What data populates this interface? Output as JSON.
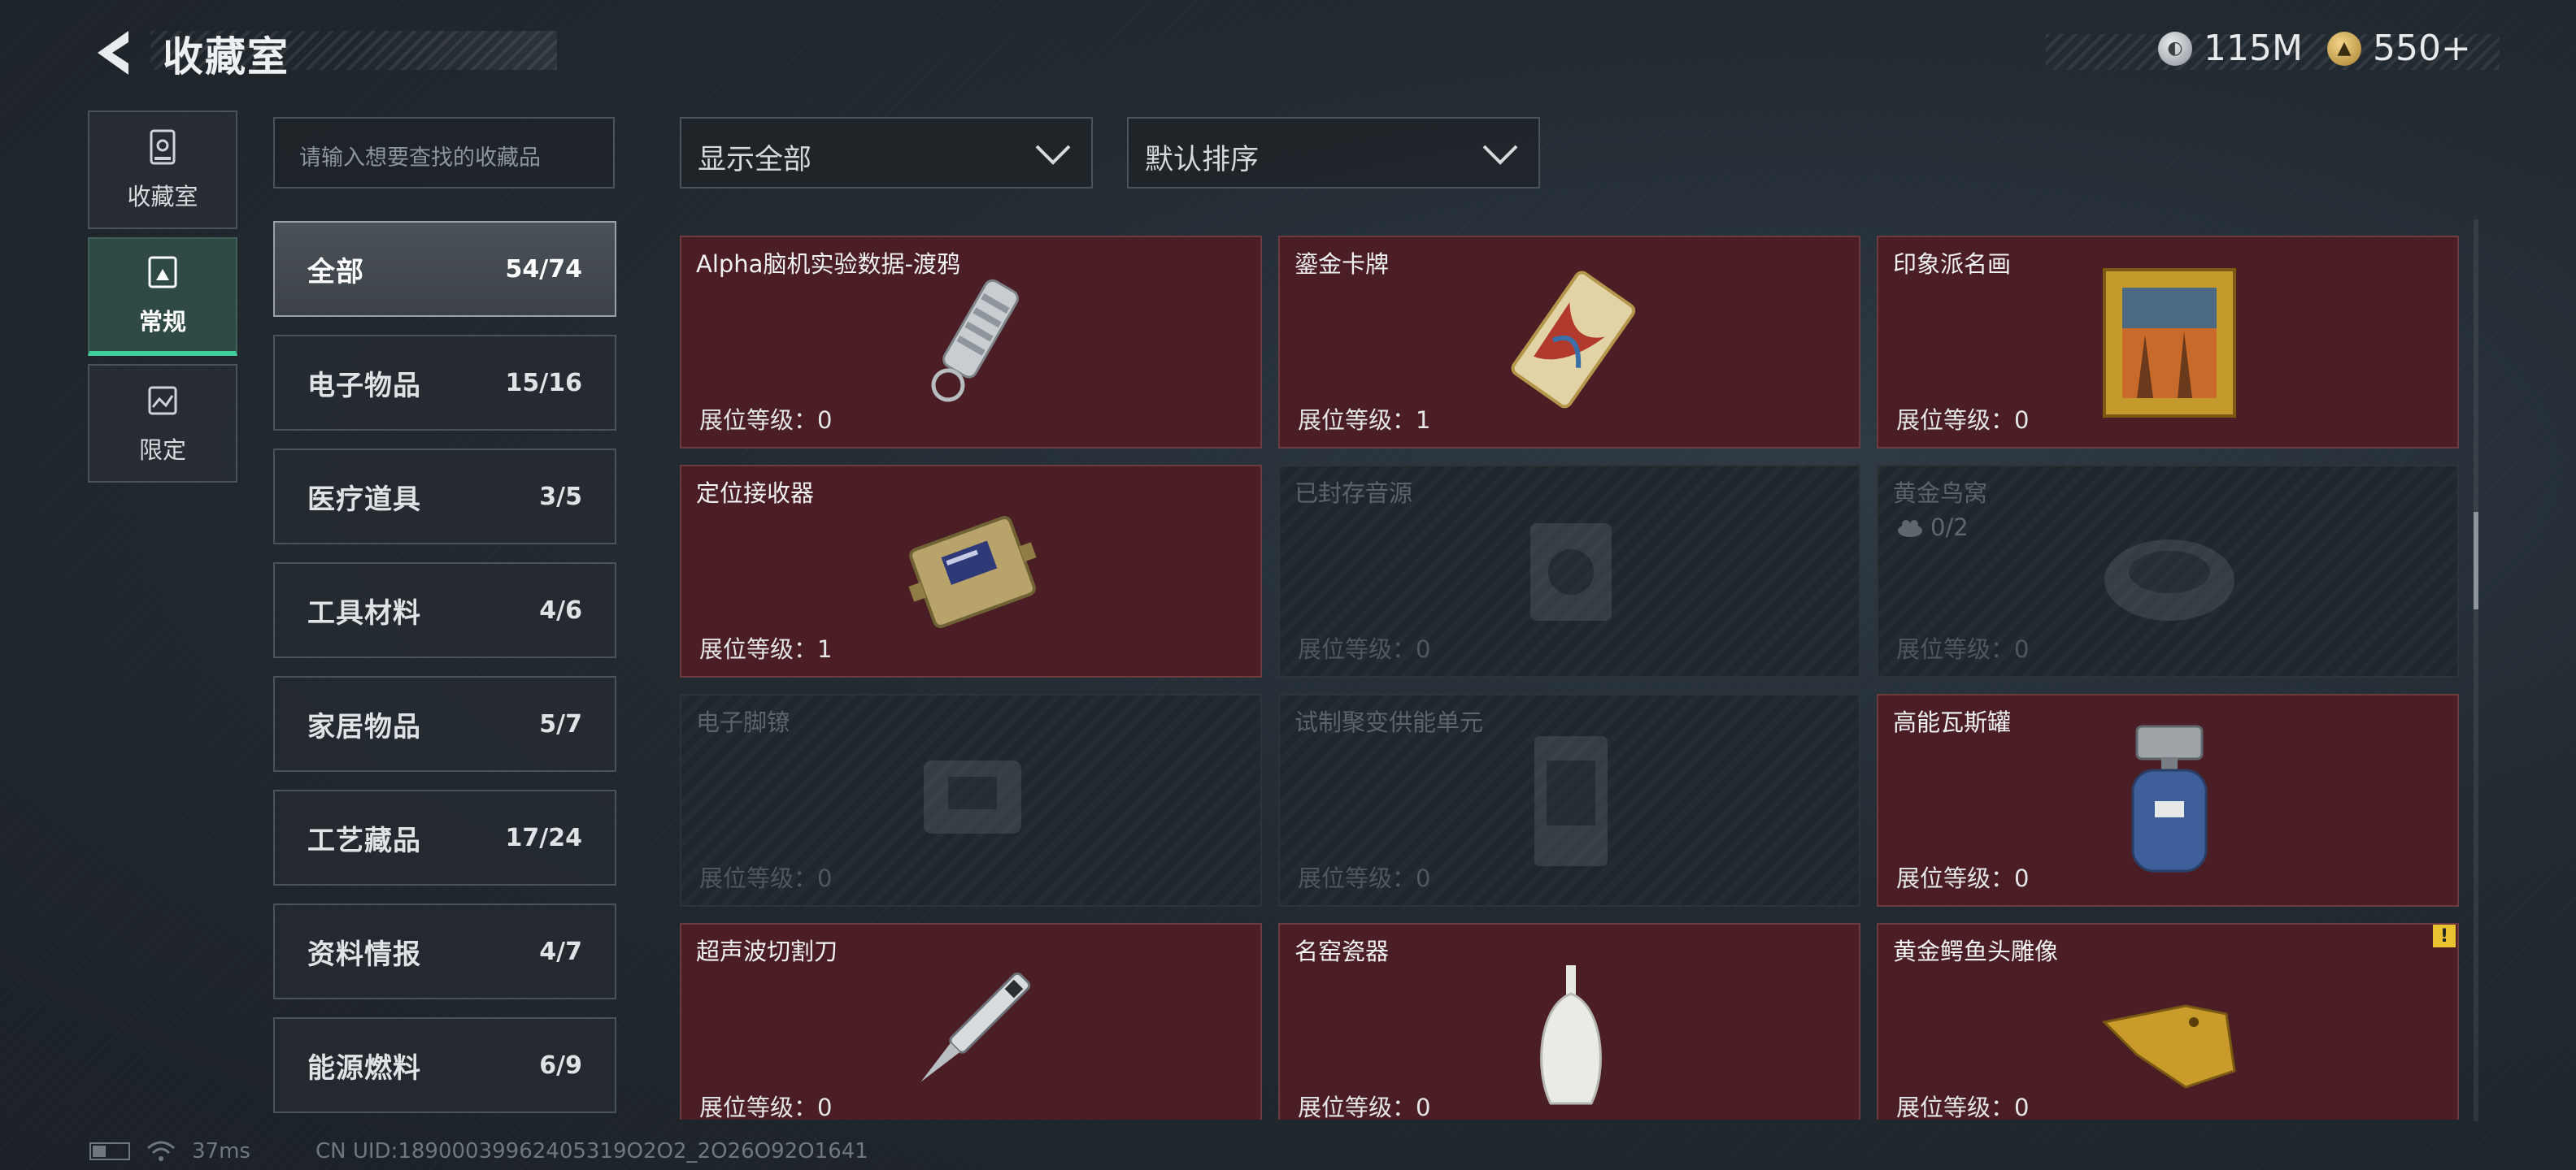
{
  "header": {
    "title": "收藏室"
  },
  "currencies": [
    {
      "icon": "silver-coin-icon",
      "value": "115M"
    },
    {
      "icon": "gold-coin-icon",
      "value": "550+"
    }
  ],
  "nav": [
    {
      "label": "收藏室",
      "icon": "collection-room-icon",
      "active": false
    },
    {
      "label": "常规",
      "icon": "regular-collection-icon",
      "active": true
    },
    {
      "label": "限定",
      "icon": "limited-collection-icon",
      "active": false
    }
  ],
  "search": {
    "placeholder": "请输入想要查找的收藏品"
  },
  "categories": [
    {
      "name": "全部",
      "count": "54/74",
      "active": true
    },
    {
      "name": "电子物品",
      "count": "15/16"
    },
    {
      "name": "医疗道具",
      "count": "3/5"
    },
    {
      "name": "工具材料",
      "count": "4/6"
    },
    {
      "name": "家居物品",
      "count": "5/7"
    },
    {
      "name": "工艺藏品",
      "count": "17/24"
    },
    {
      "name": "资料情报",
      "count": "4/7"
    },
    {
      "name": "能源燃料",
      "count": "6/9"
    }
  ],
  "filters": {
    "show": "显示全部",
    "sort": "默认排序"
  },
  "items": [
    {
      "name": "Alpha脑机实验数据-渡鸦",
      "level": "展位等级：0",
      "locked": false,
      "art": "data-drive-icon"
    },
    {
      "name": "鎏金卡牌",
      "level": "展位等级：1",
      "locked": false,
      "art": "gold-card-icon"
    },
    {
      "name": "印象派名画",
      "level": "展位等级：0",
      "locked": false,
      "art": "painting-icon"
    },
    {
      "name": "定位接收器",
      "level": "展位等级：1",
      "locked": false,
      "art": "receiver-icon"
    },
    {
      "name": "已封存音源",
      "level": "展位等级：0",
      "locked": true,
      "art": "sealed-audio-icon"
    },
    {
      "name": "黄金鸟窝",
      "level": "展位等级：0",
      "locked": true,
      "art": "golden-nest-icon",
      "progress": "0/2"
    },
    {
      "name": "电子脚镣",
      "level": "展位等级：0",
      "locked": true,
      "art": "ankle-monitor-icon"
    },
    {
      "name": "试制聚变供能单元",
      "level": "展位等级：0",
      "locked": true,
      "art": "fusion-unit-icon"
    },
    {
      "name": "高能瓦斯罐",
      "level": "展位等级：0",
      "locked": false,
      "art": "gas-tank-icon"
    },
    {
      "name": "超声波切割刀",
      "level": "展位等级：0",
      "locked": false,
      "art": "ultrasonic-knife-icon"
    },
    {
      "name": "名窑瓷器",
      "level": "展位等级：0",
      "locked": false,
      "art": "porcelain-vase-icon"
    },
    {
      "name": "黄金鳄鱼头雕像",
      "level": "展位等级：0",
      "locked": false,
      "art": "gold-crocodile-icon",
      "warning": "!"
    }
  ],
  "status": {
    "ping": "37ms",
    "uid": "CN UID:18900039962405319O2O2_2O26O92O1641"
  },
  "colors": {
    "accent": "#3fcf9c",
    "card_bg": "#4a1e24",
    "card_border": "#6d3a40",
    "locked_bg": "#1f262c"
  }
}
